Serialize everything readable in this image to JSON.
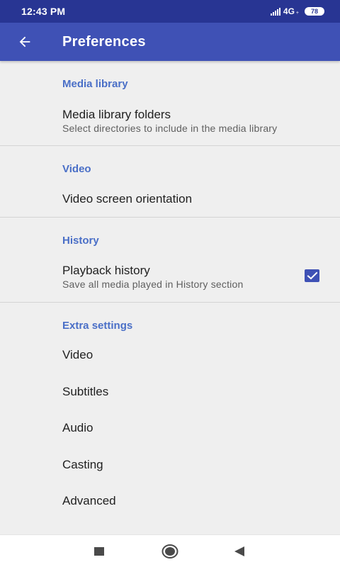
{
  "status_bar": {
    "time": "12:43 PM",
    "network": "4G",
    "network_sub": "+",
    "battery": "78"
  },
  "app_bar": {
    "title": "Preferences",
    "back_icon": "arrow-back-icon"
  },
  "sections": {
    "media_library": {
      "header": "Media library",
      "folders_title": "Media library folders",
      "folders_summary": "Select directories to include in the media library"
    },
    "video": {
      "header": "Video",
      "orientation_title": "Video screen orientation"
    },
    "history": {
      "header": "History",
      "playback_title": "Playback history",
      "playback_summary": "Save all media played in History section",
      "playback_checked": true
    },
    "extra": {
      "header": "Extra settings",
      "items": [
        "Video",
        "Subtitles",
        "Audio",
        "Casting",
        "Advanced"
      ]
    }
  },
  "nav_bar": {
    "icons": [
      "recents-square-icon",
      "home-circle-icon",
      "back-triangle-icon"
    ]
  },
  "colors": {
    "status_bar": "#283593",
    "app_bar": "#3f51b5",
    "accent": "#4a6fc7",
    "background": "#efefef"
  }
}
